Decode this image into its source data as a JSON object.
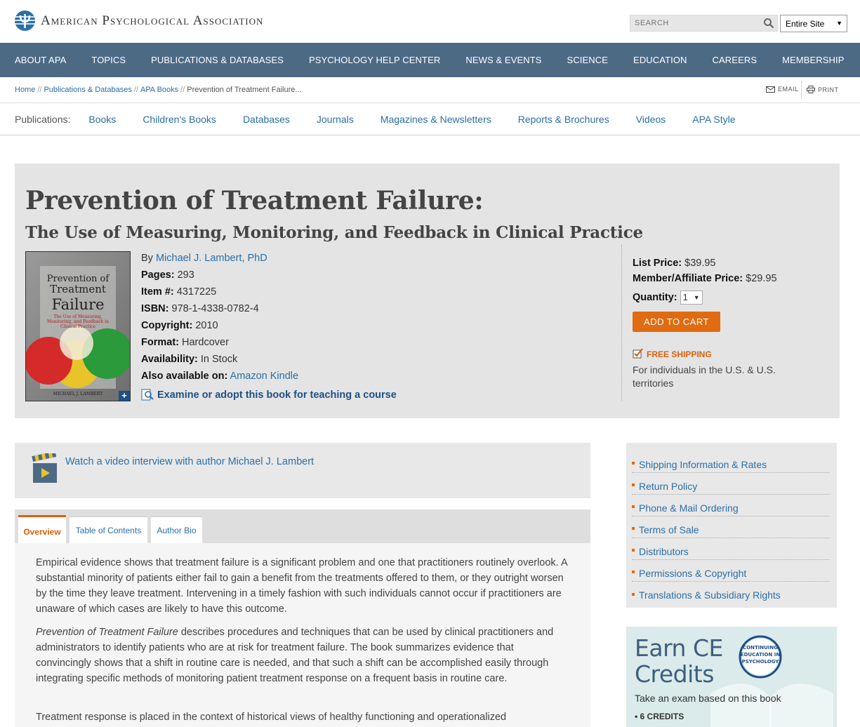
{
  "header": {
    "logo_text": "American Psychological Association",
    "search_placeholder": "SEARCH",
    "scope_selected": "Entire Site"
  },
  "nav": {
    "items": [
      "ABOUT APA",
      "TOPICS",
      "PUBLICATIONS & DATABASES",
      "PSYCHOLOGY HELP CENTER",
      "NEWS & EVENTS",
      "SCIENCE",
      "EDUCATION",
      "CAREERS",
      "MEMBERSHIP"
    ]
  },
  "breadcrumb": {
    "items": [
      "Home",
      "Publications & Databases",
      "APA Books"
    ],
    "current": "Prevention of Treatment Failure...",
    "separator": "//"
  },
  "utility": {
    "email": "EMAIL",
    "print": "PRINT"
  },
  "publications": {
    "label": "Publications:",
    "links": [
      "Books",
      "Children's Books",
      "Databases",
      "Journals",
      "Magazines & Newsletters",
      "Reports & Brochures",
      "Videos",
      "APA Style"
    ]
  },
  "book": {
    "title": "Prevention of Treatment Failure:",
    "subtitle": "The Use of Measuring, Monitoring, and Feedback in Clinical Practice",
    "cover": {
      "title_line1": "Prevention of",
      "title_line2": "Treatment",
      "title_line3": "Failure",
      "sub_line1": "The Use of Measuring,",
      "sub_line2": "Monitoring, and Feedback in",
      "sub_line3": "Clinical Practice",
      "author": "MICHAEL J. LAMBERT",
      "expand": "+"
    },
    "by_label": "By",
    "author": "Michael J. Lambert, PhD",
    "pages_label": "Pages:",
    "pages": "293",
    "item_label": "Item #:",
    "item": "4317225",
    "isbn_label": "ISBN:",
    "isbn": "978-1-4338-0782-4",
    "copyright_label": "Copyright:",
    "copyright": "2010",
    "format_label": "Format:",
    "format": "Hardcover",
    "availability_label": "Availability:",
    "availability": "In Stock",
    "also_label": "Also available on:",
    "also": "Amazon Kindle",
    "examine": "Examine or adopt this book for teaching a course"
  },
  "purchase": {
    "list_label": "List Price:",
    "list_price": "$39.95",
    "member_label": "Member/Affiliate Price:",
    "member_price": "$29.95",
    "qty_label": "Quantity:",
    "qty": "1",
    "add_to_cart": "ADD TO CART",
    "free_shipping": "FREE SHIPPING",
    "shipping_note": "For individuals in the U.S. & U.S. territories"
  },
  "video": {
    "link": "Watch a video interview with author Michael J. Lambert"
  },
  "tabs": [
    "Overview",
    "Table of Contents",
    "Author Bio"
  ],
  "overview": {
    "p1": "Empirical evidence shows that treatment failure is a significant problem and one that practitioners routinely overlook. A substantial minority of patients either fail to gain a benefit from the treatments offered to them, or they outright worsen by the time they leave treatment. Intervening in a timely fashion with such individuals cannot occur if practitioners are unaware of which cases are likely to have this outcome.",
    "p2_italic": "Prevention of Treatment Failure",
    "p2_rest": " describes procedures and techniques that can be used by clinical practitioners and administrators to identify patients who are at risk for treatment failure. The book summarizes evidence that convincingly shows that a shift in routine care is needed, and that such a shift can be accomplished easily through integrating specific methods of monitoring patient treatment response on a frequent basis in routine care.",
    "p3": "Treatment response is placed in the context of historical views of healthy functioning and operationalized"
  },
  "sidebar": {
    "links": [
      "Shipping Information & Rates",
      "Return Policy",
      "Phone & Mail Ordering",
      "Terms of Sale",
      "Distributors",
      "Permissions & Copyright",
      "Translations & Subsidiary Rights"
    ]
  },
  "ce": {
    "title_line1": "Earn CE",
    "title_line2": "Credits",
    "badge_line1": "CONTINUING",
    "badge_line2": "EDUCATION IN",
    "badge_line3": "PSYCHOLOGY",
    "subtitle": "Take an exam based on this book",
    "credits": "6 CREDITS"
  },
  "colors": {
    "nav_bg": "#4d6a85",
    "accent_orange": "#e06b10",
    "link_blue": "#2a6fa8"
  }
}
